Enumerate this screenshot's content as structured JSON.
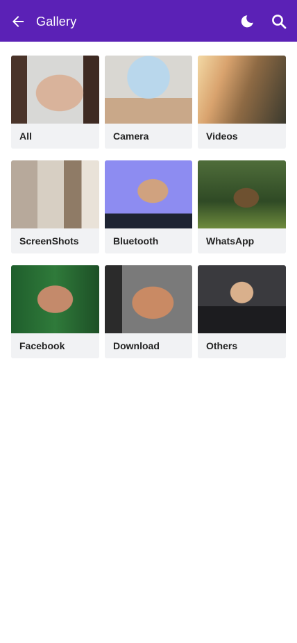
{
  "header": {
    "title": "Gallery",
    "back_icon": "arrow-left-icon",
    "theme_icon": "moon-icon",
    "search_icon": "search-icon",
    "background_color": "#5b21b6"
  },
  "albums": [
    {
      "label": "All"
    },
    {
      "label": "Camera"
    },
    {
      "label": "Videos"
    },
    {
      "label": "ScreenShots"
    },
    {
      "label": "Bluetooth"
    },
    {
      "label": "WhatsApp"
    },
    {
      "label": "Facebook"
    },
    {
      "label": "Download"
    },
    {
      "label": "Others"
    }
  ]
}
